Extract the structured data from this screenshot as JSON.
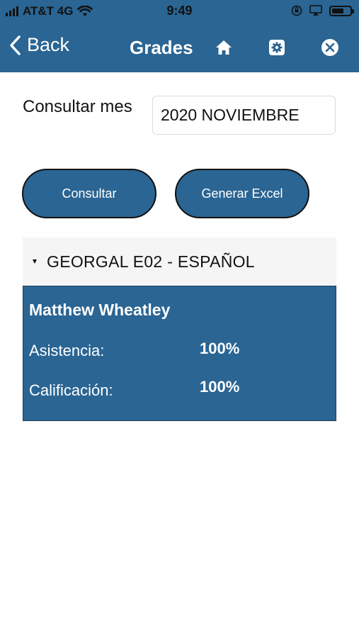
{
  "status_bar": {
    "carrier": "AT&T 4G",
    "time": "9:49"
  },
  "nav": {
    "back_label": "Back",
    "title": "Grades",
    "icons": [
      "home-icon",
      "gear-icon",
      "close-icon"
    ]
  },
  "form": {
    "month_label": "Consultar mes",
    "month_value": "2020 NOVIEMBRE"
  },
  "buttons": {
    "consult_label": "Consultar",
    "excel_label": "Generar Excel"
  },
  "group": {
    "title": "GEORGAL E02 - ESPAÑOL"
  },
  "student": {
    "name": "Matthew Wheatley",
    "attendance_label": "Asistencia:",
    "attendance_value": "100%",
    "grade_label": "Calificación:",
    "grade_value": "100%"
  },
  "colors": {
    "primary": "#2a6593",
    "header_bg": "#f5f5f5"
  }
}
